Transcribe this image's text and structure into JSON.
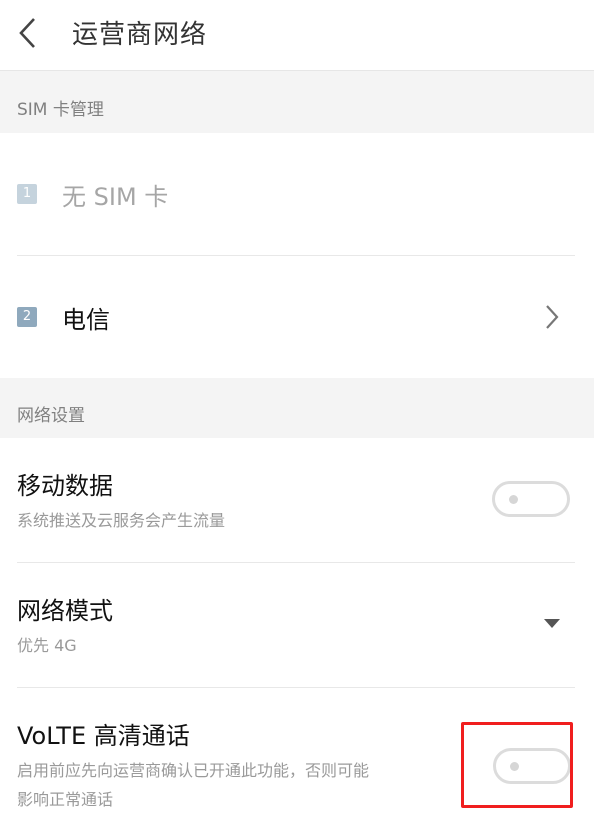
{
  "header": {
    "title": "运营商网络",
    "back_icon": "chevron-left-icon"
  },
  "sections": {
    "sim_management": {
      "label": "SIM 卡管理"
    },
    "network_settings": {
      "label": "网络设置"
    }
  },
  "sim_slots": [
    {
      "badge": "1",
      "label": "无 SIM 卡",
      "badge_color": "#c5d3dd",
      "enabled": false
    },
    {
      "badge": "2",
      "label": "电信",
      "badge_color": "#8fa9bd",
      "enabled": true,
      "icon": "chevron-right-icon"
    }
  ],
  "settings": [
    {
      "title": "移动数据",
      "subtitle": "系统推送及云服务会产生流量",
      "control": "toggle",
      "on": false
    },
    {
      "title": "网络模式",
      "subtitle": "优先 4G",
      "control": "dropdown",
      "icon": "dropdown-triangle-icon"
    },
    {
      "title": "VoLTE 高清通话",
      "subtitle_line1": "启用前应先向运营商确认已开通此功能，否则可能",
      "subtitle_line2": "影响正常通话",
      "control": "toggle",
      "on": false,
      "highlighted": true
    }
  ],
  "colors": {
    "highlight": "#f01e1e",
    "section_bg": "#f4f4f4",
    "toggle_border": "#dcdcdc"
  }
}
